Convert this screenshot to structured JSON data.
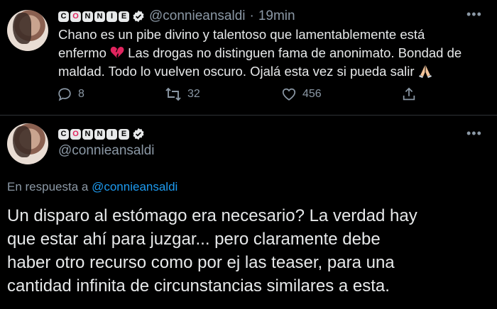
{
  "tweet1": {
    "name_letters": [
      "C",
      "O",
      "N",
      "N",
      "I",
      "E"
    ],
    "handle": "@connieansaldi",
    "separator": "·",
    "time": "19min",
    "text_line1": "Chano es un pibe divino y talentoso que lamentablemente está",
    "text_line2_a": "enfermo",
    "text_line2_b": "Las drogas no distinguen fama de anonimato. Bondad de",
    "text_line3": "maldad. Todo lo vuelven oscuro. Ojalá esta vez si pueda salir",
    "replies": "8",
    "retweets": "32",
    "likes": "456"
  },
  "tweet2": {
    "name_letters": [
      "C",
      "O",
      "N",
      "N",
      "I",
      "E"
    ],
    "handle": "@connieansaldi",
    "reply_prefix": "En respuesta a",
    "reply_to": "@connieansaldi",
    "text_line1": "Un disparo al estómago era necesario? La verdad hay",
    "text_line2": "que estar ahí para juzgar... pero claramente debe",
    "text_line3": "haber otro recurso como por ej las teaser, para una",
    "text_line4": "cantidad infinita de circunstancias similares a esta."
  },
  "colors": {
    "background": "#000000",
    "text": "#e7e9ea",
    "muted": "#8b98a5",
    "link": "#1d9bf0",
    "verified": "#e7e9ea"
  },
  "icons": [
    "reply-icon",
    "retweet-icon",
    "like-icon",
    "share-icon",
    "more-icon",
    "verified-icon",
    "broken-heart-icon",
    "praying-hands-icon"
  ]
}
